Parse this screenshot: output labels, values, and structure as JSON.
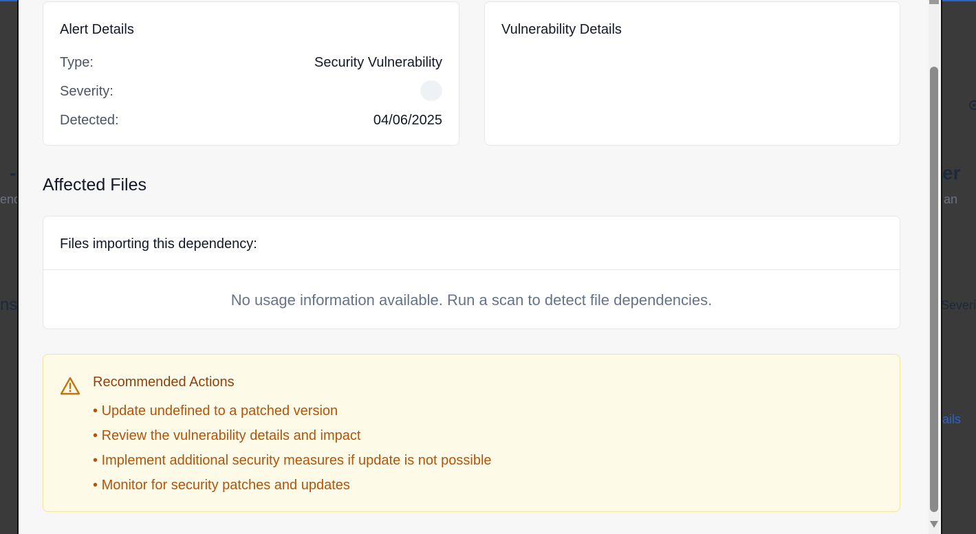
{
  "background": {
    "fragments": [
      "-",
      "end",
      "ns",
      "er",
      "an",
      "Severi",
      "ails"
    ]
  },
  "alert_details": {
    "title": "Alert Details",
    "type_label": "Type:",
    "type_value": "Security Vulnerability",
    "severity_label": "Severity:",
    "detected_label": "Detected:",
    "detected_value": "04/06/2025"
  },
  "vulnerability_details": {
    "title": "Vulnerability Details"
  },
  "affected_files": {
    "heading": "Affected Files",
    "subheading": "Files importing this dependency:",
    "empty_message": "No usage information available. Run a scan to detect file dependencies."
  },
  "recommended_actions": {
    "title": "Recommended Actions",
    "icon": "warning-triangle-icon",
    "items": [
      "Update undefined to a patched version",
      "Review the vulnerability details and impact",
      "Implement additional security measures if update is not possible",
      "Monitor for security patches and updates"
    ]
  },
  "colors": {
    "warning_text": "#b45309",
    "warning_title": "#92400e",
    "warning_bg": "#fefae8",
    "muted_text": "#64748b",
    "accent_blue": "#2b64c8"
  }
}
